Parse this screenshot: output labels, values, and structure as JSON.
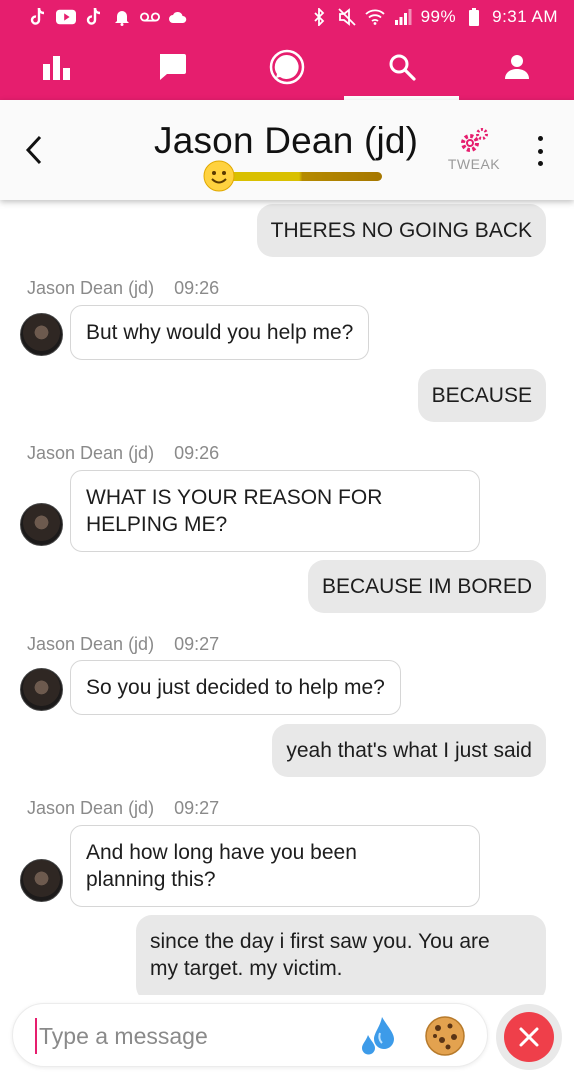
{
  "status_bar": {
    "battery": "99%",
    "time": "9:31 AM",
    "left_icons": [
      "tiktok-icon",
      "youtube-icon",
      "tiktok-icon",
      "bell-icon",
      "voicemail-icon",
      "cloud-icon"
    ],
    "right_icons": [
      "bluetooth-icon",
      "mute-icon",
      "wifi-icon",
      "signal-icon",
      "battery-icon"
    ]
  },
  "nav": {
    "items": [
      {
        "icon": "bar-chart-icon"
      },
      {
        "icon": "message-square-icon"
      },
      {
        "icon": "chat-bubble-icon"
      },
      {
        "icon": "search-icon",
        "active": true
      },
      {
        "icon": "profile-icon"
      }
    ]
  },
  "header": {
    "name": "Jason Dean  (jd)",
    "tweak_label": "TWEAK",
    "mood_icon": "smiley-icon"
  },
  "messages": {
    "m1": {
      "text": "THERES NO GOING BACK"
    },
    "m2": {
      "sender": "Jason Dean  (jd)",
      "time": "09:26",
      "text": "But why would you help me?"
    },
    "m3": {
      "text": "BECAUSE"
    },
    "m4": {
      "sender": "Jason Dean  (jd)",
      "time": "09:26",
      "text_line1": "WHAT IS YOUR REASON FOR",
      "text_line2": "HELPING ME?"
    },
    "m5": {
      "text": "BECAUSE IM BORED"
    },
    "m6": {
      "sender": "Jason Dean  (jd)",
      "time": "09:27",
      "text": "So you just decided to help me?"
    },
    "m7": {
      "text": "yeah that's what I just said"
    },
    "m8": {
      "sender": "Jason Dean  (jd)",
      "time": "09:27",
      "text_line1": "And how long have you been",
      "text_line2": "planning this?"
    },
    "m9": {
      "text_line1": "since the day i first saw you. You are",
      "text_line2": "my target. my victim."
    }
  },
  "composer": {
    "placeholder": "Type a message",
    "emoji1": "sweat-droplets-icon",
    "emoji2": "cookie-icon",
    "close": "close-icon"
  },
  "colors": {
    "brand": "#e61e6e",
    "outgoing_bubble": "#e8e8e8",
    "close_red": "#ef3f4a"
  }
}
